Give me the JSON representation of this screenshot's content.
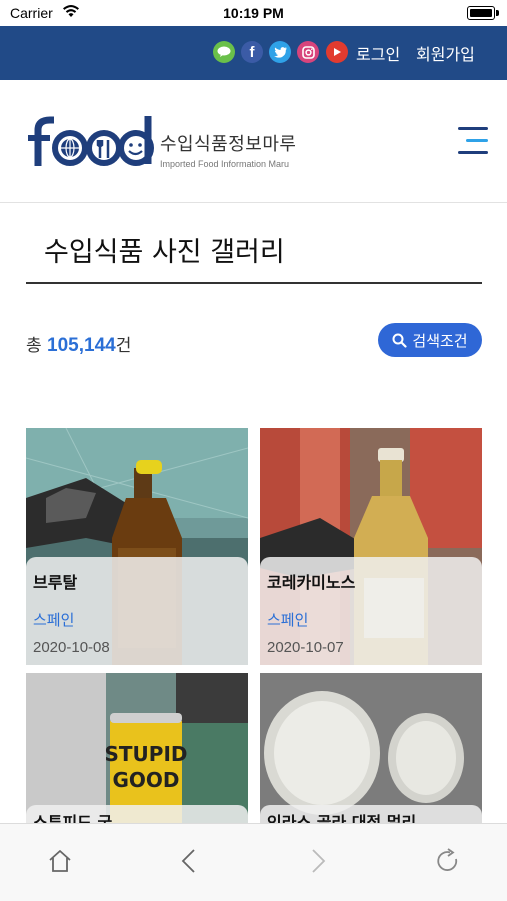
{
  "status_bar": {
    "carrier": "Carrier",
    "time": "10:19 PM"
  },
  "topbar": {
    "sns": [
      {
        "icon": "kakao-icon",
        "color": "#6ac04a",
        "glyph": "톡"
      },
      {
        "icon": "facebook-icon",
        "color": "#3b5ba6",
        "glyph": "f"
      },
      {
        "icon": "twitter-icon",
        "color": "#2fa2e8",
        "glyph": "t"
      },
      {
        "icon": "instagram-icon",
        "color": "#d8447c",
        "glyph": "◎"
      },
      {
        "icon": "youtube-icon",
        "color": "#e23b2f",
        "glyph": "▶"
      }
    ],
    "login": "로그인",
    "signup": "회원가입"
  },
  "header": {
    "logo_word": "food",
    "logo_ko": "수입식품정보마루",
    "logo_en": "Imported Food Information Maru"
  },
  "page": {
    "title": "수입식품 사진 갤러리",
    "count_prefix": "총",
    "count_value": "105,144",
    "count_suffix": "건",
    "search_label": "검색조건"
  },
  "gallery": [
    {
      "name": "브루탈",
      "country": "스페인",
      "date": "2020-10-08"
    },
    {
      "name": "코레카미노스",
      "country": "스페인",
      "date": "2020-10-07"
    },
    {
      "name": "스투피드 굿",
      "country": "",
      "date": ""
    },
    {
      "name": "인라스 골라 대접 멀리",
      "country": "",
      "date": ""
    }
  ],
  "colors": {
    "topbar": "#214a87",
    "accent": "#2f67d6",
    "logo": "#1f3e7c"
  }
}
